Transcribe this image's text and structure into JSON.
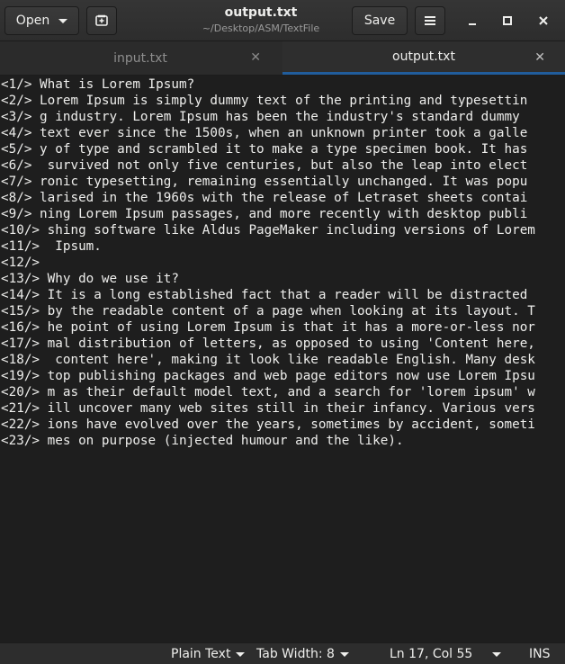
{
  "header": {
    "open_label": "Open",
    "save_label": "Save",
    "title": "output.txt",
    "subtitle": "~/Desktop/ASM/TextFile"
  },
  "tabs": [
    {
      "label": "input.txt",
      "active": false
    },
    {
      "label": "output.txt",
      "active": true
    }
  ],
  "editor": {
    "lines": [
      "<1/> What is Lorem Ipsum?",
      "<2/> Lorem Ipsum is simply dummy text of the printing and typesettin",
      "<3/> g industry. Lorem Ipsum has been the industry's standard dummy ",
      "<4/> text ever since the 1500s, when an unknown printer took a galle",
      "<5/> y of type and scrambled it to make a type specimen book. It has",
      "<6/>  survived not only five centuries, but also the leap into elect",
      "<7/> ronic typesetting, remaining essentially unchanged. It was popu",
      "<8/> larised in the 1960s with the release of Letraset sheets contai",
      "<9/> ning Lorem Ipsum passages, and more recently with desktop publi",
      "<10/> shing software like Aldus PageMaker including versions of Lorem",
      "<11/>  Ipsum.",
      "<12/>",
      "<13/> Why do we use it?",
      "<14/> It is a long established fact that a reader will be distracted ",
      "<15/> by the readable content of a page when looking at its layout. T",
      "<16/> he point of using Lorem Ipsum is that it has a more-or-less nor",
      "<17/> mal distribution of letters, as opposed to using 'Content here,",
      "<18/>  content here', making it look like readable English. Many desk",
      "<19/> top publishing packages and web page editors now use Lorem Ipsu",
      "<20/> m as their default model text, and a search for 'lorem ipsum' w",
      "<21/> ill uncover many web sites still in their infancy. Various vers",
      "<22/> ions have evolved over the years, sometimes by accident, someti",
      "<23/> mes on purpose (injected humour and the like)."
    ]
  },
  "statusbar": {
    "language": "Plain Text",
    "tab_width": "Tab Width: 8",
    "position": "Ln 17, Col 55",
    "mode": "INS"
  },
  "icons": {
    "new_tab": "new-document-icon",
    "menu": "hamburger-menu-icon",
    "minimize": "minimize-icon",
    "maximize": "maximize-icon",
    "close": "close-icon"
  }
}
